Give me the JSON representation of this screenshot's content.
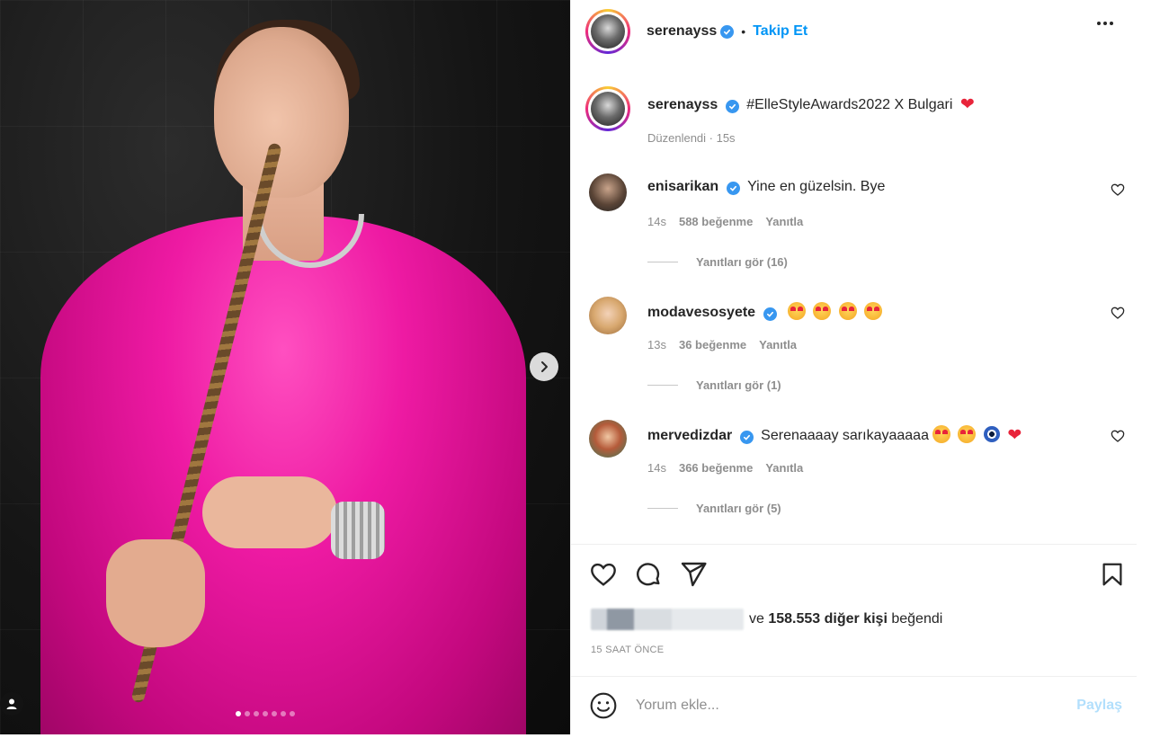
{
  "post": {
    "username": "serenayss",
    "follow_label": "Takip Et",
    "caption": "#ElleStyleAwards2022 X Bulgari",
    "caption_meta": "Düzenlendi · 15s",
    "image_slides_total": 7,
    "image_slide_active": 1
  },
  "comments": [
    {
      "username": "enisarikan",
      "text": "Yine en güzelsin. Bye",
      "time": "14s",
      "likes": "588 beğenme",
      "reply": "Yanıtla",
      "view_replies": "Yanıtları gör (16)"
    },
    {
      "username": "modavesosyete",
      "text": "",
      "time": "13s",
      "likes": "36 beğenme",
      "reply": "Yanıtla",
      "view_replies": "Yanıtları gör (1)"
    },
    {
      "username": "mervedizdar",
      "text": "Serenaaaay sarıkayaaaaa",
      "time": "14s",
      "likes": "366 beğenme",
      "reply": "Yanıtla",
      "view_replies": "Yanıtları gör (5)"
    }
  ],
  "likes": {
    "prefix": "ve",
    "count": "158.553 diğer kişi",
    "suffix": "beğendi"
  },
  "timestamp": "15 SAAT ÖNCE",
  "comment_input": {
    "placeholder": "Yorum ekle...",
    "post_label": "Paylaş"
  },
  "colors": {
    "accent": "#0095f6",
    "verified": "#3897f0",
    "outfit_pink": "#ee1aa3",
    "muted_text": "#8e8e8e"
  }
}
